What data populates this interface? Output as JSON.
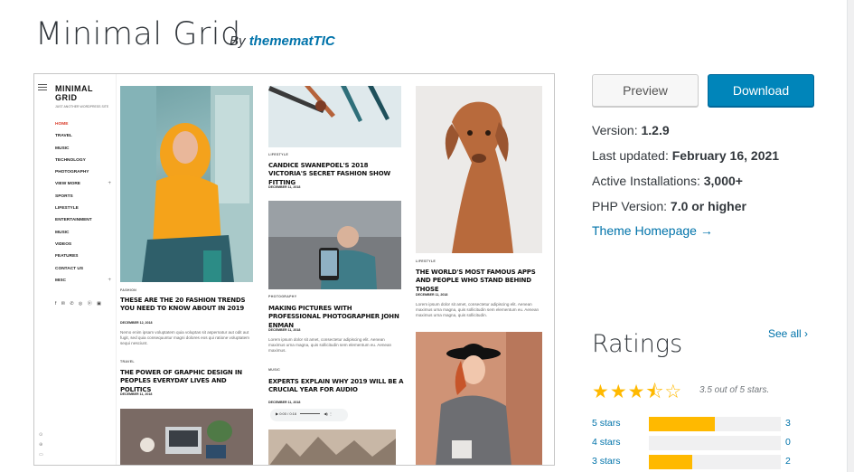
{
  "theme": {
    "title": "Minimal Grid",
    "by_label": "By",
    "author": "themematTIC"
  },
  "preview": {
    "brand_line1": "MINIMAL",
    "brand_line2": "GRID",
    "tagline": "JUST ANOTHER WORDPRESS SITE",
    "menu": [
      {
        "label": "HOME",
        "active": true
      },
      {
        "label": "TRAVEL"
      },
      {
        "label": "MUSIC"
      },
      {
        "label": "TECHNOLOGY"
      },
      {
        "label": "PHOTOGRAPHY"
      },
      {
        "label": "VIEW MORE",
        "plus": "+"
      },
      {
        "label": "SPORTS"
      },
      {
        "label": "LIFESTYLE"
      },
      {
        "label": "ENTERTAINMENT"
      },
      {
        "label": "MUSIC"
      },
      {
        "label": "VIDEOS"
      },
      {
        "label": "FEATURES"
      },
      {
        "label": "CONTACT US"
      },
      {
        "label": "MISC",
        "plus": "+"
      }
    ],
    "socials": "f ✉ ✆ ◎ ⓟ ▣",
    "side_tools": [
      "⊙",
      "⊕",
      "▭"
    ],
    "posts": {
      "p1": {
        "cat": "FASHION",
        "title": "THESE ARE THE 20 FASHION TRENDS YOU NEED TO KNOW ABOUT IN 2019",
        "date": "DECEMBER 12, 2018",
        "excerpt": "Nemo enim ipsam voluptatem quia voluptas sit aspernatur aut odit aut fugit, sed quia consequuntur magni dolores eos qui ratione voluptatem sequi nesciunt."
      },
      "p2": {
        "cat": "TRAVEL",
        "title": "THE POWER OF GRAPHIC DESIGN IN PEOPLES EVERYDAY LIVES AND POLITICS",
        "date": "DECEMBER 11, 2018"
      },
      "p3": {
        "cat": "LIFESTYLE",
        "title": "CANDICE SWANEPOEL'S 2018 VICTORIA'S SECRET FASHION SHOW FITTING",
        "date": "DECEMBER 11, 2018"
      },
      "p4": {
        "cat": "PHOTOGRAPHY",
        "title": "MAKING PICTURES WITH PROFESSIONAL PHOTOGRAPHER JOHN ENMAN",
        "date": "DECEMBER 11, 2018",
        "excerpt": "Lorem ipsum dolor sit amet, consectetur adipiscing elit. Aenean maximus urna magna, quis sollicitudin sem elementum eu. Aenean maximus."
      },
      "p5": {
        "cat": "MUSIC",
        "title": "EXPERTS EXPLAIN WHY 2019 WILL BE A CRUCIAL YEAR FOR AUDIO",
        "date": "DECEMBER 11, 2018",
        "audio": "0:00 / 0:16"
      },
      "p6": {
        "cat": "LIFESTYLE",
        "title": "THE WORLD'S MOST FAMOUS APPS AND PEOPLE WHO STAND BEHIND THOSE",
        "date": "DECEMBER 11, 2018",
        "excerpt": "Lorem ipsum dolor sit amet, consectetur adipiscing elit. Aenean maximus urna magna, quis sollicitudin sem elementum eu. Aenean maximus urna magna, quis sollicitudin."
      }
    }
  },
  "actions": {
    "preview": "Preview",
    "download": "Download"
  },
  "meta": {
    "version_label": "Version:",
    "version": "1.2.9",
    "updated_label": "Last updated:",
    "updated": "February 16, 2021",
    "installs_label": "Active Installations:",
    "installs": "3,000+",
    "php_label": "PHP Version:",
    "php": "7.0 or higher",
    "homepage": "Theme Homepage →"
  },
  "ratings": {
    "heading": "Ratings",
    "see_all": "See all ›",
    "average": 3.5,
    "caption": "3.5 out of 5 stars.",
    "rows": [
      {
        "label": "5 stars",
        "count": "3",
        "fraction": 0.5
      },
      {
        "label": "4 stars",
        "count": "0",
        "fraction": 0
      },
      {
        "label": "3 stars",
        "count": "2",
        "fraction": 0.33
      }
    ]
  },
  "colors": {
    "link": "#0073aa",
    "download": "#0085ba",
    "star": "#ffb900",
    "active_menu": "#d93c2a"
  }
}
